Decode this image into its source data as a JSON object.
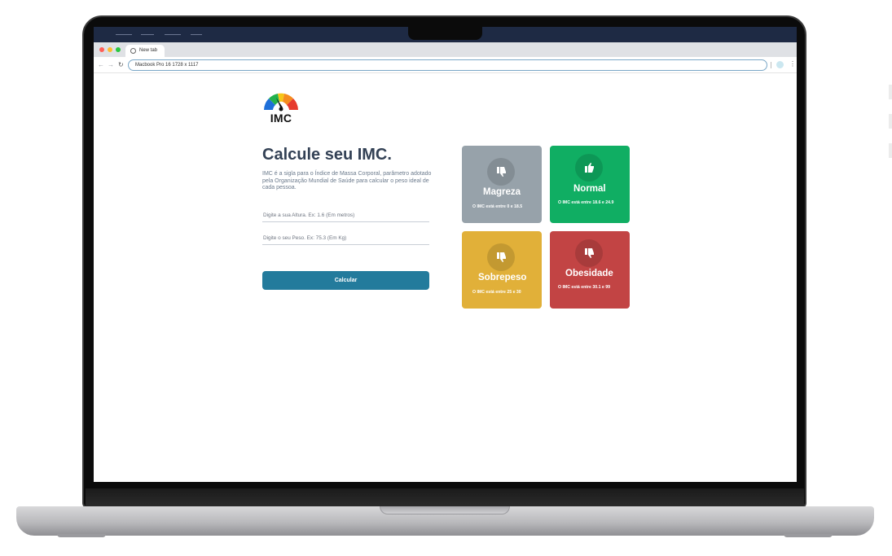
{
  "browser": {
    "tab_title": "New tab",
    "url": "Macbook Pro 16  1728 x 1117",
    "back_icon": "arrow-left",
    "forward_icon": "arrow-right",
    "reload_icon": "↻"
  },
  "app": {
    "logo_text": "IMC",
    "title": "Calcule seu IMC.",
    "description": "IMC é a sigla para o Índice de Massa Corporal, parâmetro adotado pela Organização Mundial de Saúde para calcular o peso ideal de cada pessoa.",
    "height_placeholder": "Digite a sua Altura. Ex: 1.6 (Em metros)",
    "weight_placeholder": "Digite o seu Peso. Ex: 75.3 (Em Kg)",
    "calculate_label": "Calcular"
  },
  "cards": [
    {
      "title": "Magreza",
      "range": "O IMC está entre 0 e 18.5",
      "icon": "thumbs-down",
      "color": "#97a2aa"
    },
    {
      "title": "Normal",
      "range": "O IMC está entre 18.6 e 24.9",
      "icon": "thumbs-up",
      "color": "#10ae63"
    },
    {
      "title": "Sobrepeso",
      "range": "O IMC está entre 25 e 30",
      "icon": "thumbs-down",
      "color": "#e1b039"
    },
    {
      "title": "Obesidade",
      "range": "O IMC está entre 30.1 e 99",
      "icon": "thumbs-down",
      "color": "#c24444"
    }
  ]
}
